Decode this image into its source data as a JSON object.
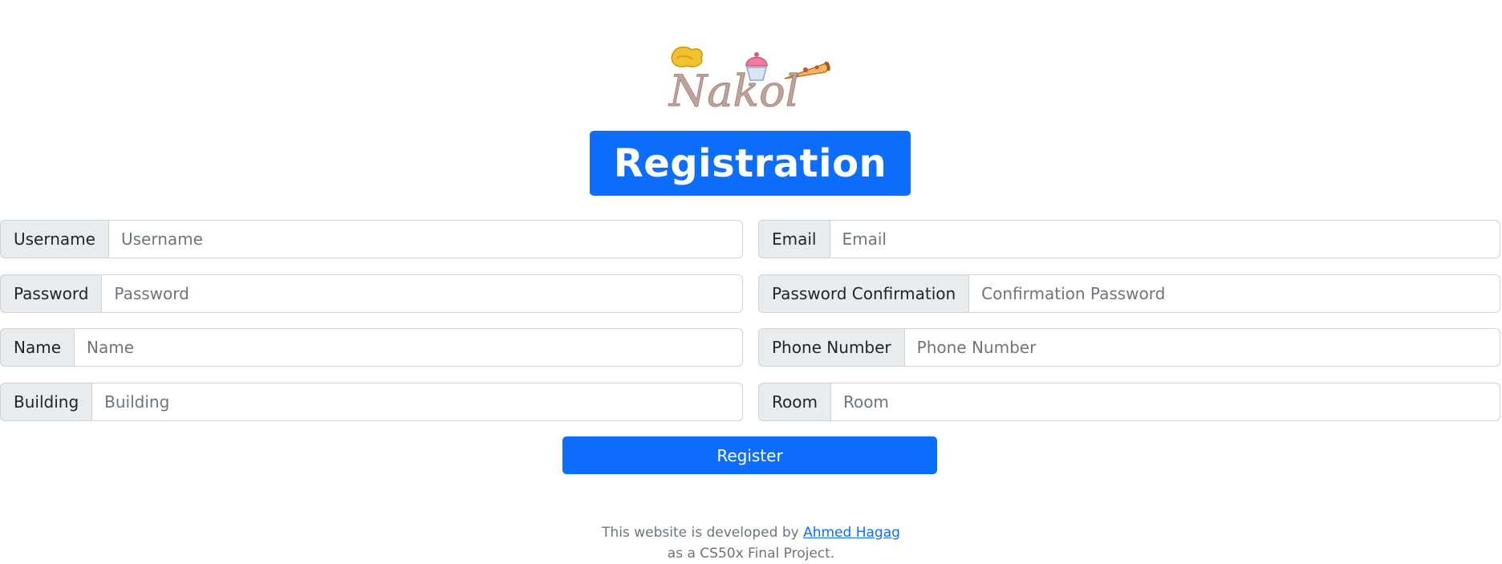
{
  "logo": {
    "text": "Nakol"
  },
  "page_title": "Registration",
  "fields": {
    "username": {
      "label": "Username",
      "placeholder": "Username"
    },
    "email": {
      "label": "Email",
      "placeholder": "Email"
    },
    "password": {
      "label": "Password",
      "placeholder": "Password"
    },
    "password_confirmation": {
      "label": "Password Confirmation",
      "placeholder": "Confirmation Password"
    },
    "name": {
      "label": "Name",
      "placeholder": "Name"
    },
    "phone": {
      "label": "Phone Number",
      "placeholder": "Phone Number"
    },
    "building": {
      "label": "Building",
      "placeholder": "Building"
    },
    "room": {
      "label": "Room",
      "placeholder": "Room"
    }
  },
  "register_label": "Register",
  "footer": {
    "line1_prefix": "This website is developed by ",
    "author_link": "Ahmed Hagag",
    "line2": "as a CS50x Final Project."
  },
  "colors": {
    "primary": "#0d6efd",
    "addon_bg": "#e9ecef",
    "border": "#ced4da"
  }
}
